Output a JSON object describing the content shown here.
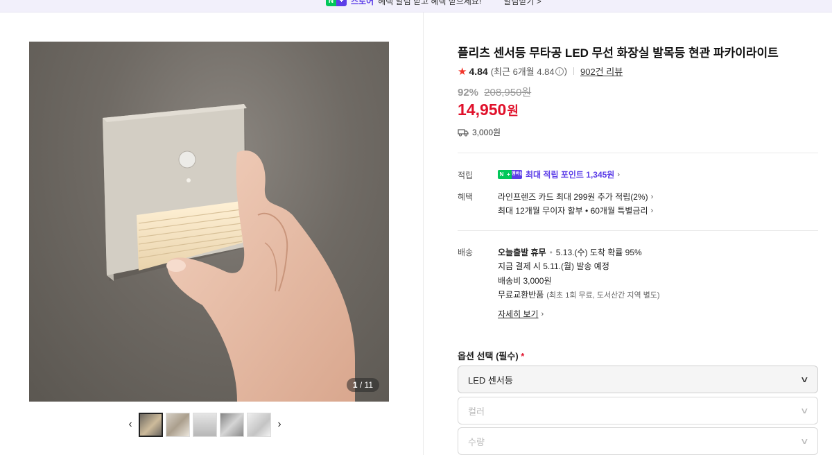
{
  "banner": {
    "badge_n": "N",
    "badge_plus": "+",
    "brand": "스토어",
    "message": "혜택 알림 받고 혜택 받으세요!",
    "link": "알림받기 >"
  },
  "gallery": {
    "counter_current": "1",
    "counter_total": "11",
    "thumbnails_count": 5,
    "prev_icon": "chevron-left-icon",
    "next_icon": "chevron-right-icon"
  },
  "product": {
    "title": "플리츠 센서등 무타공 LED 무선 화장실 발목등 현관 파카이라이트",
    "rating": "4.84",
    "rating_recent": "(최근 6개월 4.84",
    "rating_recent_close": ")",
    "reviews": "902건 리뷰",
    "discount_rate": "92%",
    "original_price": "208,950원",
    "sale_price": "14,950",
    "sale_unit": "원",
    "shipping_fee": "3,000원",
    "price_color": "#e0102a"
  },
  "benefits": {
    "points_label": "적립",
    "points_badge": "멤버십",
    "points_text": "최대 적립 포인트 1,345원",
    "benefit_label": "혜택",
    "benefit_line1": "라인프렌즈 카드 최대 299원 추가 적립(2%)",
    "benefit_line2": "최대 12개월 무이자 할부 • 60개월 특별금리"
  },
  "delivery": {
    "label": "배송",
    "today": "오늘출발 휴무",
    "arrival": "5.13.(수) 도착 확률 95%",
    "dispatch": "지금 결제 시 5.11.(월) 발송 예정",
    "fee": "배송비 3,000원",
    "return_title": "무료교환반품",
    "return_note": "(최초 1회 무료, 도서산간 지역 별도)",
    "details_link": "자세히 보기"
  },
  "options": {
    "title": "옵션 선택 (필수)",
    "required_mark": "*",
    "selects": [
      {
        "value": "LED 센서등"
      },
      {
        "placeholder": "컬러"
      },
      {
        "placeholder": "수량"
      }
    ]
  }
}
